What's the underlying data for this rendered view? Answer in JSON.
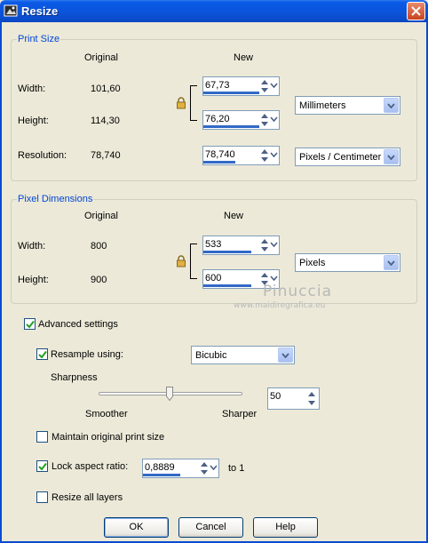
{
  "window": {
    "title": "Resize",
    "title_icon": "resize-app-icon",
    "close_icon": "close-icon"
  },
  "print_size": {
    "legend": "Print Size",
    "col_original": "Original",
    "col_new": "New",
    "width_label": "Width:",
    "width_original": "101,60",
    "width_new": "67,73",
    "height_label": "Height:",
    "height_original": "114,30",
    "height_new": "76,20",
    "unit": "Millimeters",
    "resolution_label": "Resolution:",
    "resolution_original": "78,740",
    "resolution_new": "78,740",
    "resolution_unit": "Pixels / Centimeter"
  },
  "pixel_dimensions": {
    "legend": "Pixel Dimensions",
    "col_original": "Original",
    "col_new": "New",
    "width_label": "Width:",
    "width_original": "800",
    "width_new": "533",
    "height_label": "Height:",
    "height_original": "900",
    "height_new": "600",
    "unit": "Pixels"
  },
  "watermark": {
    "line1": "Pinuccia",
    "line2": "www.maidiregrafica.eu"
  },
  "advanced": {
    "advanced_settings_label": "Advanced settings",
    "advanced_settings_checked": true,
    "resample_label": "Resample using:",
    "resample_checked": true,
    "resample_method": "Bicubic",
    "sharpness_label": "Sharpness",
    "smoother_label": "Smoother",
    "sharper_label": "Sharper",
    "sharpness_value": "50",
    "sharpness_slider_fraction": 0.5,
    "maintain_print_label": "Maintain original print size",
    "maintain_print_checked": false,
    "lock_aspect_label": "Lock aspect ratio:",
    "lock_aspect_checked": true,
    "aspect_value": "0,8889",
    "aspect_suffix": "to 1",
    "resize_all_label": "Resize all layers",
    "resize_all_checked": false
  },
  "buttons": {
    "ok": "OK",
    "cancel": "Cancel",
    "help": "Help"
  },
  "colors": {
    "accent": "#0046d5",
    "titlebar": "#0b53d8",
    "field_progress": "#3169c6"
  }
}
